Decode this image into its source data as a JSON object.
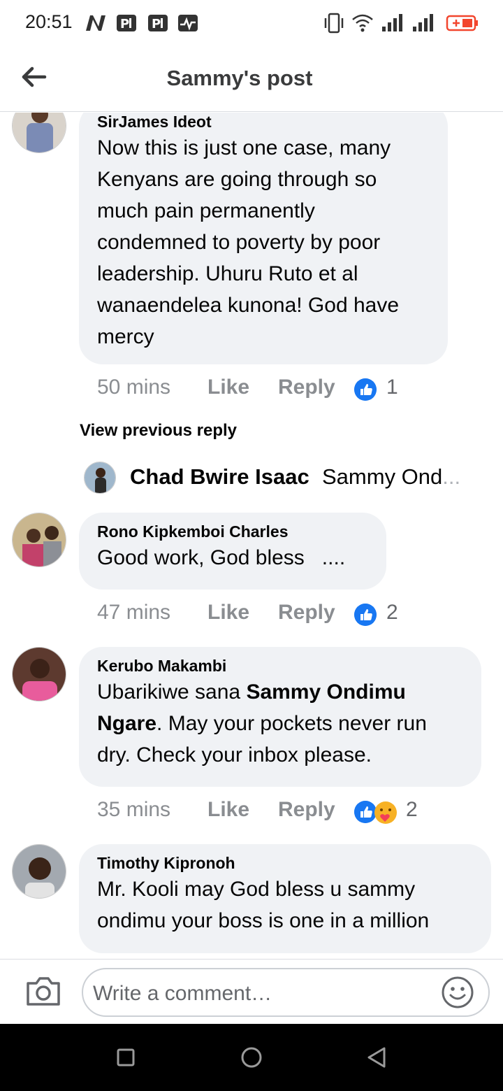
{
  "status_bar": {
    "time": "20:51",
    "left_icons": [
      "n-notification-icon",
      "parking-icon",
      "parking-icon",
      "activity-icon"
    ],
    "right_icons": [
      "vibrate-icon",
      "wifi-icon",
      "signal-icon",
      "signal-icon",
      "battery-charging-icon"
    ],
    "battery_color": "#f2462e"
  },
  "header": {
    "title": "Sammy's post",
    "back_icon": "arrow-left-icon"
  },
  "comments": [
    {
      "author": "SirJames Ideot",
      "text": "Now this is just one case, many Kenyans are going through so much pain permanently condemned to poverty by poor leadership. Uhuru Ruto et al wanaendelea kunona! God have mercy",
      "time": "50 mins",
      "like_label": "Like",
      "reply_label": "Reply",
      "reaction_count": "1",
      "reactions": [
        "like-icon"
      ]
    },
    {
      "author": "Rono Kipkemboi Charles",
      "text": "Good work, God bless   ....",
      "time": "47 mins",
      "like_label": "Like",
      "reply_label": "Reply",
      "reaction_count": "2",
      "reactions": [
        "like-icon"
      ]
    },
    {
      "author": "Kerubo Makambi",
      "text_parts": [
        "Ubarikiwe sana ",
        "Sammy Ondimu Ngare",
        ". May your pockets never run dry. Check your inbox please."
      ],
      "time": "35 mins",
      "like_label": "Like",
      "reply_label": "Reply",
      "reaction_count": "2",
      "reactions": [
        "like-icon",
        "care-icon"
      ]
    },
    {
      "author": "Timothy Kipronoh",
      "text": "Mr. Kooli may God bless u sammy ondimu your boss is one in a million"
    }
  ],
  "view_previous_reply": "View previous reply",
  "reply_preview": {
    "name": "Chad Bwire Isaac",
    "snippet": "Sammy Ond",
    "ellipsis": "..."
  },
  "composer": {
    "placeholder": "Write a comment…",
    "camera_icon": "camera-icon",
    "emoji_icon": "smiley-icon"
  },
  "nav_bar": {
    "buttons": [
      "recents-square-icon",
      "home-circle-icon",
      "back-triangle-icon"
    ]
  },
  "colors": {
    "bubble": "#f0f2f5",
    "like_blue": "#1877f2",
    "meta_gray": "#8a8d91"
  }
}
